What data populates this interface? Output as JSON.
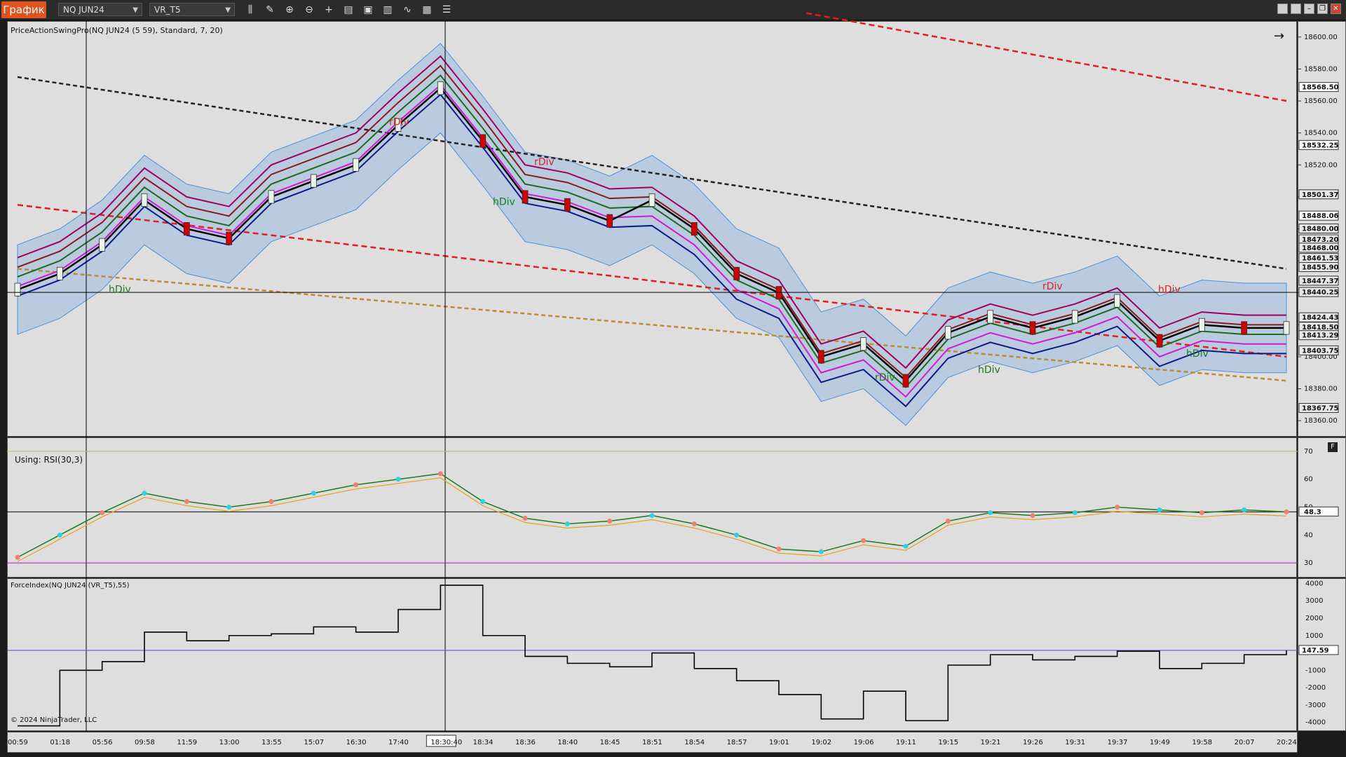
{
  "toolbar": {
    "app_button": "График",
    "instrument": "NQ JUN24",
    "bar_type": "VR_T5"
  },
  "price_panel": {
    "indicator_label": "PriceActionSwingPro(NQ JUN24 (5 59), Standard, 7, 20)",
    "ticks": [
      "18600.00",
      "18580.00",
      "18560.00",
      "18540.00",
      "18520.00",
      "18500.00",
      "18480.00",
      "18460.00",
      "18440.00",
      "18420.00",
      "18400.00",
      "18380.00",
      "18360.00"
    ],
    "badges": [
      "18568.50",
      "18532.25",
      "18501.37",
      "18488.06",
      "18480.00",
      "18473.20",
      "18468.00",
      "18461.53",
      "18455.90",
      "18447.37",
      "18440.25",
      "18424.43",
      "18418.50",
      "18413.29",
      "18403.75",
      "18367.75"
    ],
    "annotations": [
      "rDiv",
      "hDiv",
      "rDiv",
      "hDiv",
      "rDiv",
      "hDiv",
      "rDiv",
      "hDiv",
      "hDiv"
    ]
  },
  "rsi_panel": {
    "label": "Using: RSI(30,3)",
    "ticks": [
      "70",
      "60",
      "50",
      "40",
      "30"
    ],
    "badge": "48.3",
    "corner_button": "F"
  },
  "force_panel": {
    "label": "ForceIndex(NQ JUN24 (VR_T5),55)",
    "ticks": [
      "4000",
      "3000",
      "2000",
      "1000",
      "0",
      "-1000",
      "-2000",
      "-3000",
      "-4000"
    ],
    "badge": "147.59",
    "copyright": "© 2024 NinjaTrader, LLC"
  },
  "time_axis": {
    "labels": [
      "00:59",
      "01:18",
      "05:56",
      "09:58",
      "11:59",
      "13:00",
      "13:55",
      "15:07",
      "16:30",
      "17:40",
      "18:30:40",
      "18:34",
      "18:36",
      "18:40",
      "18:45",
      "18:51",
      "18:54",
      "18:57",
      "19:01",
      "19:02",
      "19:06",
      "19:11",
      "19:15",
      "19:21",
      "19:26",
      "19:31",
      "19:37",
      "19:49",
      "19:58",
      "20:07",
      "20:24"
    ],
    "selected": "18:30:40"
  },
  "chart_data": {
    "type": "line",
    "title": "PriceActionSwingPro(NQ JUN24 (5 59), Standard, 7, 20)",
    "x": [
      "00:59",
      "01:18",
      "05:56",
      "09:58",
      "11:59",
      "13:00",
      "13:55",
      "15:07",
      "16:30",
      "17:40",
      "18:30:40",
      "18:34",
      "18:36",
      "18:40",
      "18:45",
      "18:51",
      "18:54",
      "18:57",
      "19:01",
      "19:02",
      "19:06",
      "19:11",
      "19:15",
      "19:21",
      "19:26",
      "19:31",
      "19:37",
      "19:49",
      "19:58",
      "20:07",
      "20:24"
    ],
    "series": [
      {
        "values": [
          18442,
          18452,
          18470,
          18498,
          18480,
          18474,
          18500,
          18510,
          18520,
          18545,
          18568,
          18535,
          18500,
          18495,
          18485,
          18498,
          18480,
          18452,
          18440,
          18400,
          18408,
          18385,
          18415,
          18425,
          18418,
          18425,
          18435,
          18410,
          18420,
          18418,
          18418
        ]
      }
    ],
    "ylim": [
      18350,
      18610
    ],
    "rsi": {
      "values": [
        32,
        40,
        48,
        55,
        52,
        50,
        52,
        55,
        58,
        60,
        62,
        52,
        46,
        44,
        45,
        47,
        44,
        40,
        35,
        34,
        38,
        36,
        45,
        48,
        47,
        48,
        50,
        49,
        48,
        49,
        48.3
      ],
      "ylim": [
        25,
        75
      ]
    },
    "force_index": {
      "values": [
        -4200,
        -1000,
        -500,
        1200,
        700,
        1000,
        1100,
        1500,
        1200,
        2500,
        3900,
        1000,
        -200,
        -600,
        -800,
        0,
        -900,
        -1600,
        -2400,
        -3800,
        -2200,
        -3900,
        -700,
        -100,
        -400,
        -200,
        100,
        -900,
        -600,
        -100,
        147.59
      ],
      "ylim": [
        -4500,
        4300
      ]
    }
  }
}
